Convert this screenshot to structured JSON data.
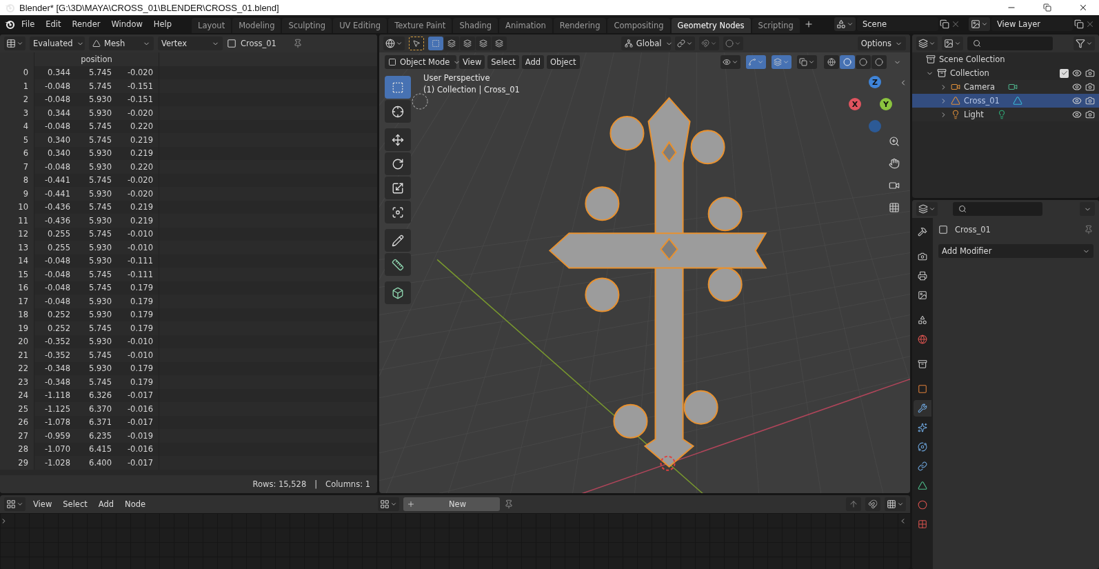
{
  "title_bar": {
    "title": "Blender* [G:\\3D\\MAYA\\CROSS_01\\BLENDER\\CROSS_01.blend]"
  },
  "menu_bar": {
    "items": [
      "File",
      "Edit",
      "Render",
      "Window",
      "Help"
    ]
  },
  "workspace_tabs": [
    {
      "label": "Layout",
      "selected": false
    },
    {
      "label": "Modeling",
      "selected": false
    },
    {
      "label": "Sculpting",
      "selected": false
    },
    {
      "label": "UV Editing",
      "selected": false
    },
    {
      "label": "Texture Paint",
      "selected": false
    },
    {
      "label": "Shading",
      "selected": false
    },
    {
      "label": "Animation",
      "selected": false
    },
    {
      "label": "Rendering",
      "selected": false
    },
    {
      "label": "Compositing",
      "selected": false
    },
    {
      "label": "Geometry Nodes",
      "selected": true
    },
    {
      "label": "Scripting",
      "selected": false
    }
  ],
  "scene": {
    "label": "Scene"
  },
  "view_layer": {
    "label": "View Layer"
  },
  "spreadsheet": {
    "evaluation": "Evaluated",
    "geometry": "Mesh",
    "domain": "Vertex",
    "object": "Cross_01",
    "column": "position",
    "rows": [
      {
        "index": "0",
        "values": [
          "0.344",
          "5.745",
          "-0.020"
        ]
      },
      {
        "index": "1",
        "values": [
          "-0.048",
          "5.745",
          "-0.151"
        ]
      },
      {
        "index": "2",
        "values": [
          "-0.048",
          "5.930",
          "-0.151"
        ]
      },
      {
        "index": "3",
        "values": [
          "0.344",
          "5.930",
          "-0.020"
        ]
      },
      {
        "index": "4",
        "values": [
          "-0.048",
          "5.745",
          "0.220"
        ]
      },
      {
        "index": "5",
        "values": [
          "0.340",
          "5.745",
          "0.219"
        ]
      },
      {
        "index": "6",
        "values": [
          "0.340",
          "5.930",
          "0.219"
        ]
      },
      {
        "index": "7",
        "values": [
          "-0.048",
          "5.930",
          "0.220"
        ]
      },
      {
        "index": "8",
        "values": [
          "-0.441",
          "5.745",
          "-0.020"
        ]
      },
      {
        "index": "9",
        "values": [
          "-0.441",
          "5.930",
          "-0.020"
        ]
      },
      {
        "index": "10",
        "values": [
          "-0.436",
          "5.745",
          "0.219"
        ]
      },
      {
        "index": "11",
        "values": [
          "-0.436",
          "5.930",
          "0.219"
        ]
      },
      {
        "index": "12",
        "values": [
          "0.255",
          "5.745",
          "-0.010"
        ]
      },
      {
        "index": "13",
        "values": [
          "0.255",
          "5.930",
          "-0.010"
        ]
      },
      {
        "index": "14",
        "values": [
          "-0.048",
          "5.930",
          "-0.111"
        ]
      },
      {
        "index": "15",
        "values": [
          "-0.048",
          "5.745",
          "-0.111"
        ]
      },
      {
        "index": "16",
        "values": [
          "-0.048",
          "5.745",
          "0.179"
        ]
      },
      {
        "index": "17",
        "values": [
          "-0.048",
          "5.930",
          "0.179"
        ]
      },
      {
        "index": "18",
        "values": [
          "0.252",
          "5.930",
          "0.179"
        ]
      },
      {
        "index": "19",
        "values": [
          "0.252",
          "5.745",
          "0.179"
        ]
      },
      {
        "index": "20",
        "values": [
          "-0.352",
          "5.930",
          "-0.010"
        ]
      },
      {
        "index": "21",
        "values": [
          "-0.352",
          "5.745",
          "-0.010"
        ]
      },
      {
        "index": "22",
        "values": [
          "-0.348",
          "5.930",
          "0.179"
        ]
      },
      {
        "index": "23",
        "values": [
          "-0.348",
          "5.745",
          "0.179"
        ]
      },
      {
        "index": "24",
        "values": [
          "-1.118",
          "6.326",
          "-0.017"
        ]
      },
      {
        "index": "25",
        "values": [
          "-1.125",
          "6.370",
          "-0.016"
        ]
      },
      {
        "index": "26",
        "values": [
          "-1.078",
          "6.371",
          "-0.017"
        ]
      },
      {
        "index": "27",
        "values": [
          "-0.959",
          "6.235",
          "-0.019"
        ]
      },
      {
        "index": "28",
        "values": [
          "-1.070",
          "6.415",
          "-0.016"
        ]
      },
      {
        "index": "29",
        "values": [
          "-1.028",
          "6.400",
          "-0.017"
        ]
      }
    ],
    "rows_count": "Rows: 15,528",
    "separator": "|",
    "columns_count": "Columns: 1"
  },
  "viewport": {
    "select_modes": [
      {
        "selected": true
      },
      {
        "selected": false
      },
      {
        "selected": false
      },
      {
        "selected": false
      },
      {
        "selected": false
      }
    ],
    "transform": "Global",
    "header_toggles": [
      {
        "kind": "snap",
        "on": false
      },
      {
        "kind": "proportional",
        "on": false
      }
    ],
    "options": "Options",
    "mode": "Object Mode",
    "menus": [
      "View",
      "Select",
      "Add",
      "Object"
    ],
    "overlay_toggles": [
      {
        "kind": "visibility",
        "on": false
      },
      {
        "kind": "gizmo",
        "on": true
      },
      {
        "kind": "overlays",
        "on": true
      },
      {
        "kind": "xray",
        "on": false
      }
    ],
    "shading": [
      {
        "kind": "wireframe",
        "selected": false
      },
      {
        "kind": "solid",
        "selected": true
      },
      {
        "kind": "material",
        "selected": false
      },
      {
        "kind": "rendered",
        "selected": false
      }
    ],
    "tools": [
      {
        "kind": "select",
        "selected": true
      },
      {
        "kind": "cursor",
        "selected": false
      },
      {
        "kind": "move",
        "selected": false
      },
      {
        "kind": "rotate",
        "selected": false
      },
      {
        "kind": "scale",
        "selected": false
      },
      {
        "kind": "transform",
        "selected": false
      },
      {
        "kind": "annotate",
        "selected": false
      },
      {
        "kind": "measure",
        "selected": false
      },
      {
        "kind": "add_cube",
        "selected": false
      }
    ],
    "view_name": "User Perspective",
    "view_info": "(1) Collection | Cross_01",
    "gizmo_axes": [
      "X",
      "Y",
      "Z"
    ]
  },
  "outliner": {
    "root": "Scene Collection",
    "items": [
      {
        "label": "Collection",
        "kind": "collection",
        "checked": true,
        "expanded": true,
        "selected": false,
        "children": [
          {
            "label": "Camera",
            "kind": "camera",
            "expanded": false,
            "selected": false
          },
          {
            "label": "Cross_01",
            "kind": "mesh",
            "expanded": false,
            "selected": true
          },
          {
            "label": "Light",
            "kind": "light",
            "expanded": false,
            "selected": false
          }
        ]
      }
    ]
  },
  "properties": {
    "tabs": [
      {
        "kind": "tool",
        "selected": false
      },
      {
        "kind": "render",
        "selected": false
      },
      {
        "kind": "output",
        "selected": false
      },
      {
        "kind": "view_layer",
        "selected": false
      },
      {
        "kind": "scene",
        "selected": false
      },
      {
        "kind": "world",
        "selected": false
      },
      {
        "kind": "collection",
        "selected": false
      },
      {
        "kind": "object",
        "selected": false
      },
      {
        "kind": "modifiers",
        "selected": true
      },
      {
        "kind": "particles",
        "selected": false
      },
      {
        "kind": "physics",
        "selected": false
      },
      {
        "kind": "constraints",
        "selected": false
      },
      {
        "kind": "data",
        "selected": false
      },
      {
        "kind": "material",
        "selected": false
      },
      {
        "kind": "texture",
        "selected": false
      }
    ],
    "object": "Cross_01",
    "add_modifier": "Add Modifier"
  },
  "node_editor": {
    "menus": [
      "View",
      "Select",
      "Add",
      "Node"
    ],
    "new_button": "New"
  }
}
